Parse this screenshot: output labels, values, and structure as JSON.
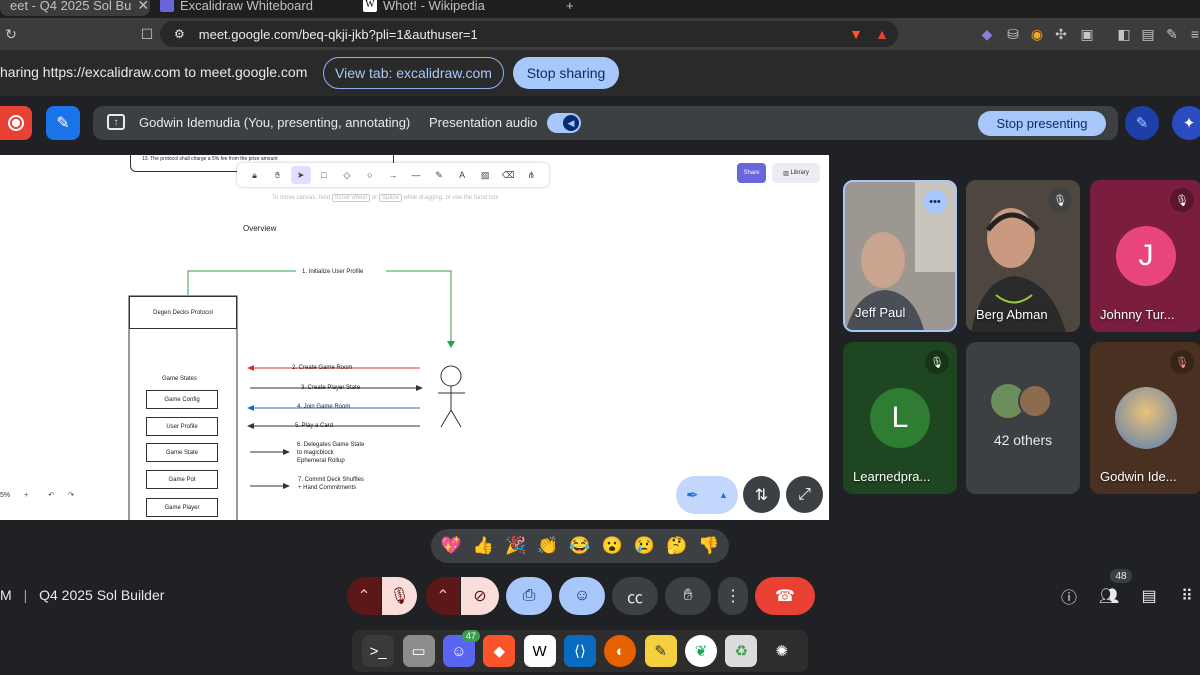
{
  "browser": {
    "tabs": [
      {
        "label": "eet - Q4 2025 Sol Bu"
      },
      {
        "label": "Excalidraw Whiteboard"
      },
      {
        "label": "Whot! - Wikipedia"
      }
    ],
    "new_tab_label": "+",
    "url": "meet.google.com/beq-qkji-jkb?pli=1&authuser=1"
  },
  "share_bar": {
    "text": "haring https://excalidraw.com to meet.google.com",
    "view_tab_label": "View tab: excalidraw.com",
    "stop_sharing_label": "Stop sharing"
  },
  "meet_bar": {
    "presenter_label": "Godwin Idemudia (You, presenting, annotating)",
    "audio_label": "Presentation audio",
    "stop_presenting_label": "Stop presenting"
  },
  "excalidraw": {
    "share_label": "Share",
    "library_label": "Library",
    "hint_prefix": "To move canvas, hold",
    "hint_key1": "Scroll wheel",
    "hint_mid": "or",
    "hint_key2": "Space",
    "hint_suffix": "while dragging, or use the hand tool",
    "protocol_note": "13. The protocol shall charge a 5% fee from the prize amount",
    "overview": "Overview",
    "protocol_box": "Degen Decks Protocol",
    "game_states": "Game States",
    "boxes": [
      "Game Config",
      "User Profile",
      "Game State",
      "Game Pot",
      "Game Player"
    ],
    "steps": [
      "1. Initialize User Profile",
      "2. Create Game Room",
      "3. Create Player State",
      "4. Join Game Room",
      "5. Play a Card",
      "6. Delegates Game State",
      "to magicblock",
      "Ephemeral Rollup",
      "7. Commit Deck Shuffles",
      "+ Hand Commitments"
    ],
    "zoom": "5%",
    "zoom_plus": "+"
  },
  "participants": [
    {
      "name": "Jeff Paul"
    },
    {
      "name": "Berg Abman"
    },
    {
      "name": "Johnny Tur...",
      "initial": "J"
    },
    {
      "name": "Learnedpra...",
      "initial": "L"
    },
    {
      "name": "42 others"
    },
    {
      "name": "Godwin Ide..."
    }
  ],
  "reactions": [
    "💖",
    "👍",
    "🎉",
    "👏",
    "😂",
    "😮",
    "😢",
    "🤔",
    "👎"
  ],
  "meeting": {
    "info_prefix": "M",
    "name": "Q4 2025 Sol Builder",
    "participant_count": "48"
  },
  "colors": {
    "meet_bg": "#202124",
    "accent_blue": "#a8c7fa",
    "leave_red": "#e94235",
    "excalidraw_purple": "#6965db",
    "green_tile": "#1e4620",
    "pink_tile": "#7a1d3f",
    "brown_tile": "#4a3020"
  },
  "dock_apps": [
    "terminal",
    "files",
    "discord",
    "brave",
    "wps",
    "vscode",
    "firefox",
    "notes",
    "mongodb",
    "trash",
    "ubuntu-logo"
  ]
}
